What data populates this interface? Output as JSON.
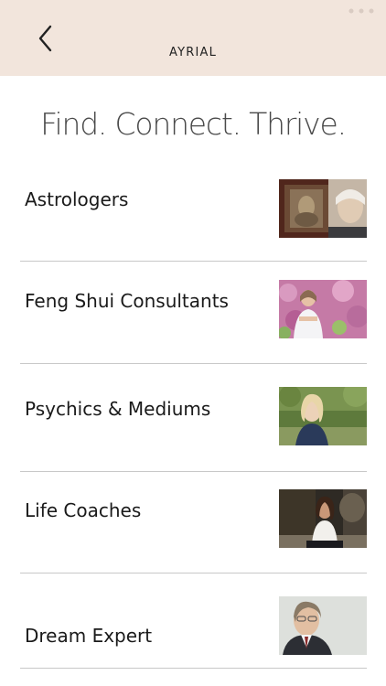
{
  "header": {
    "title": "AYRIAL",
    "back_icon": "chevron-left-icon",
    "background": "#f2e5dc"
  },
  "tagline": "Find. Connect. Thrive.",
  "categories": [
    {
      "label": "Astrologers",
      "image": "astrologer-photo"
    },
    {
      "label": "Feng Shui Consultants",
      "image": "feng-shui-consultant-photo"
    },
    {
      "label": "Psychics & Mediums",
      "image": "psychic-medium-photo"
    },
    {
      "label": "Life Coaches",
      "image": "life-coach-photo"
    },
    {
      "label": "Dream Expert",
      "image": "dream-expert-photo"
    }
  ]
}
